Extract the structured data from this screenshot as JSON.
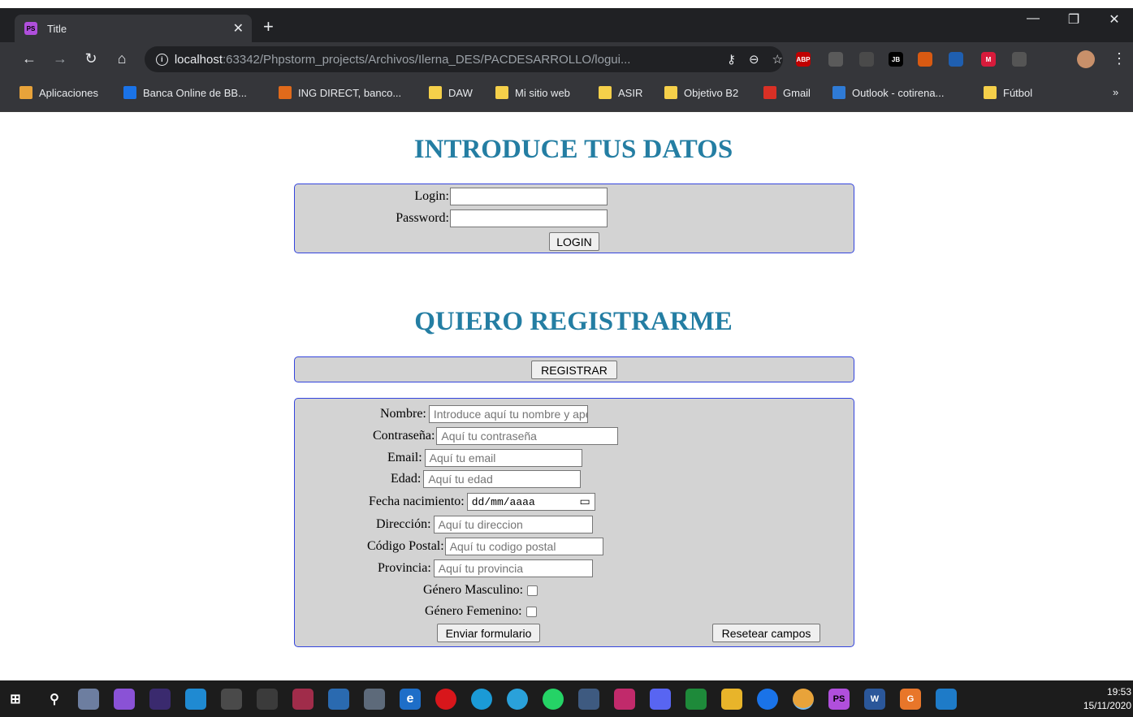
{
  "browser": {
    "tab_title": "Title",
    "tab_icon_text": "PS",
    "url_host": "localhost",
    "url_rest": ":63342/Phpstorm_projects/Archivos/Ilerna_DES/PACDESARROLLO/logui...",
    "extensions": [
      {
        "name": "abp-icon",
        "text": "ABP",
        "color": "#c00000"
      },
      {
        "name": "reader-icon",
        "text": "",
        "color": "#5a5a5a"
      },
      {
        "name": "puzzle-dark-icon",
        "text": "",
        "color": "#4a4a4a"
      },
      {
        "name": "jetbrains-icon",
        "text": "JB",
        "color": "#000000"
      },
      {
        "name": "vpn-icon",
        "text": "",
        "color": "#d85a12"
      },
      {
        "name": "feather-icon",
        "text": "",
        "color": "#1f5fb0"
      },
      {
        "name": "mail-ext-icon",
        "text": "M",
        "color": "#d81b3b"
      },
      {
        "name": "gear-ext-icon",
        "text": "",
        "color": "#555555"
      },
      {
        "name": "extensions-icon",
        "text": "",
        "color": "#35363a"
      }
    ]
  },
  "bookmarks": [
    {
      "label": "Aplicaciones",
      "icon": "apps-grid-icon",
      "color": "#e8a33a"
    },
    {
      "label": "Banca Online de BB...",
      "icon": "bank-icon",
      "color": "#1a73e8"
    },
    {
      "label": "ING DIRECT, banco...",
      "icon": "ing-icon",
      "color": "#e06a1b"
    },
    {
      "label": "DAW",
      "icon": "folder-icon",
      "color": "#f5d04a"
    },
    {
      "label": "Mi sitio web",
      "icon": "folder-icon",
      "color": "#f5d04a"
    },
    {
      "label": "ASIR",
      "icon": "folder-icon",
      "color": "#f5d04a"
    },
    {
      "label": "Objetivo B2",
      "icon": "folder-icon",
      "color": "#f5d04a"
    },
    {
      "label": "Gmail",
      "icon": "gmail-icon",
      "color": "#d93025"
    },
    {
      "label": "Outlook - cotirena...",
      "icon": "outlook-icon",
      "color": "#2f7bd6"
    },
    {
      "label": "Fútbol",
      "icon": "folder-icon",
      "color": "#f5d04a"
    }
  ],
  "bookmarks_more": "»",
  "login": {
    "heading": "INTRODUCE TUS DATOS",
    "login_label": "Login:",
    "password_label": "Password:",
    "login_value": "",
    "password_value": "",
    "button": "LOGIN"
  },
  "register": {
    "heading": "QUIERO REGISTRARME",
    "button": "REGISTRAR"
  },
  "form": {
    "nombre_label": "Nombre:",
    "nombre_placeholder": "Introduce aquí tu nombre y apellidos",
    "contrasena_label": "Contraseña:",
    "contrasena_placeholder": "Aquí tu contraseña",
    "email_label": "Email:",
    "email_placeholder": "Aquí tu email",
    "edad_label": "Edad:",
    "edad_placeholder": "Aquí tu edad",
    "fecha_label": "Fecha nacimiento:",
    "fecha_placeholder": "dd/mm/aaaa",
    "direccion_label": "Dirección:",
    "direccion_placeholder": "Aquí tu direccion",
    "cp_label": "Código Postal:",
    "cp_placeholder": "Aquí tu codigo postal",
    "provincia_label": "Provincia:",
    "provincia_placeholder": "Aquí tu provincia",
    "masculino_label": "Género Masculino:",
    "femenino_label": "Género Femenino:",
    "submit": "Enviar formulario",
    "reset": "Resetear campos"
  },
  "taskbar": {
    "time": "19:53",
    "date": "15/11/2020"
  }
}
